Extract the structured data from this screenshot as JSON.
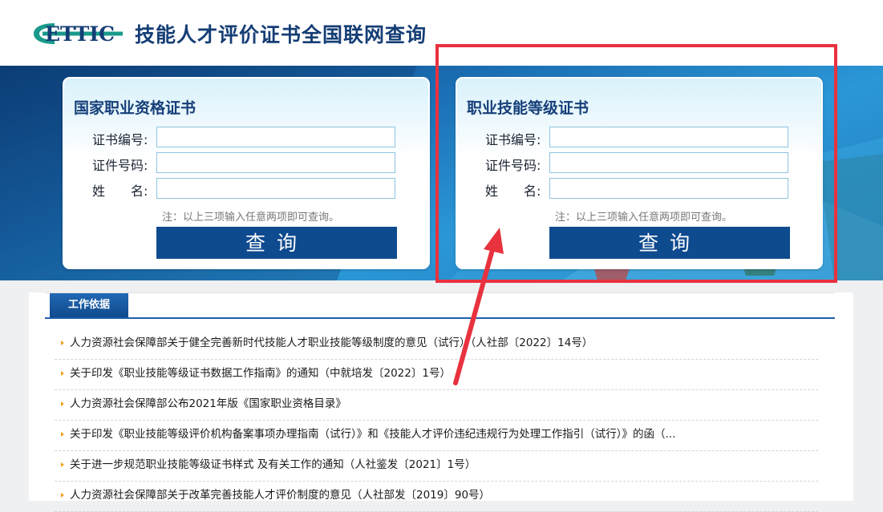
{
  "header": {
    "logo_text": "ETTIC",
    "title": "技能人才评价证书全国联网查询"
  },
  "cards": [
    {
      "title": "国家职业资格证书",
      "labels": [
        "证书编号:",
        "证件号码:",
        "姓　　名:"
      ],
      "note": "注：以上三项输入任意两项即可查询。",
      "button": "查询"
    },
    {
      "title": "职业技能等级证书",
      "labels": [
        "证书编号:",
        "证件号码:",
        "姓　　名:"
      ],
      "note": "注：以上三项输入任意两项即可查询。",
      "button": "查询"
    }
  ],
  "section": {
    "tab": "工作依据",
    "items": [
      "人力资源社会保障部关于健全完善新时代技能人才职业技能等级制度的意见（试行）（人社部〔2022〕14号）",
      "关于印发《职业技能等级证书数据工作指南》的通知（中就培发〔2022〕1号）",
      "人力资源社会保障部公布2021年版《国家职业资格目录》",
      "关于印发《职业技能等级评价机构备案事项办理指南（试行）》和《技能人才评价违纪违规行为处理工作指引（试行）》的函（...",
      "关于进一步规范职业技能等级证书样式 及有关工作的通知（人社鉴发〔2021〕1号）",
      "人力资源社会保障部关于改革完善技能人才评价制度的意见（人社部发〔2019〕90号）"
    ]
  },
  "colors": {
    "primary": "#0e4a8e",
    "annotation": "#e8323e",
    "bullet": "#f0a020"
  }
}
